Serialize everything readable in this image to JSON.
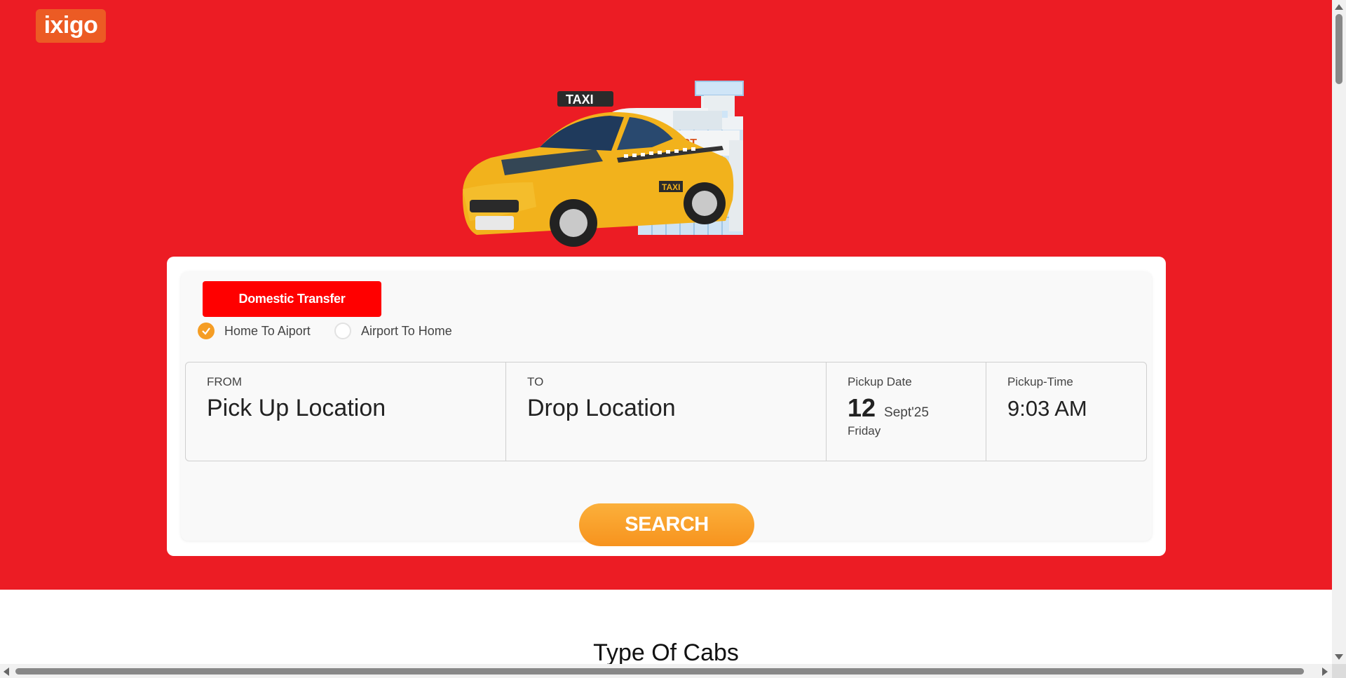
{
  "brand": {
    "logo_text": "ixigo",
    "logo_color": "#ec5b24",
    "hero_color": "#ec1c24"
  },
  "illustration": {
    "taxi_sign": "TAXI",
    "door_sign": "TAXI",
    "building_sign": "AIRPORT"
  },
  "booking": {
    "tab_label": "Domestic Transfer",
    "trip_options": [
      {
        "label": "Home To Aiport",
        "selected": true
      },
      {
        "label": "Airport To Home",
        "selected": false
      }
    ],
    "from": {
      "label": "FROM",
      "placeholder": "Pick Up Location"
    },
    "to": {
      "label": "TO",
      "placeholder": "Drop Location"
    },
    "pickup_date": {
      "label": "Pickup Date",
      "day": "12",
      "month_year": "Sept'25",
      "weekday": "Friday"
    },
    "pickup_time": {
      "label": "Pickup-Time",
      "value": "9:03 AM"
    },
    "search_label": "SEARCH",
    "accent_color": "#f59d24"
  },
  "sections": {
    "cab_types_title": "Type Of Cabs"
  }
}
